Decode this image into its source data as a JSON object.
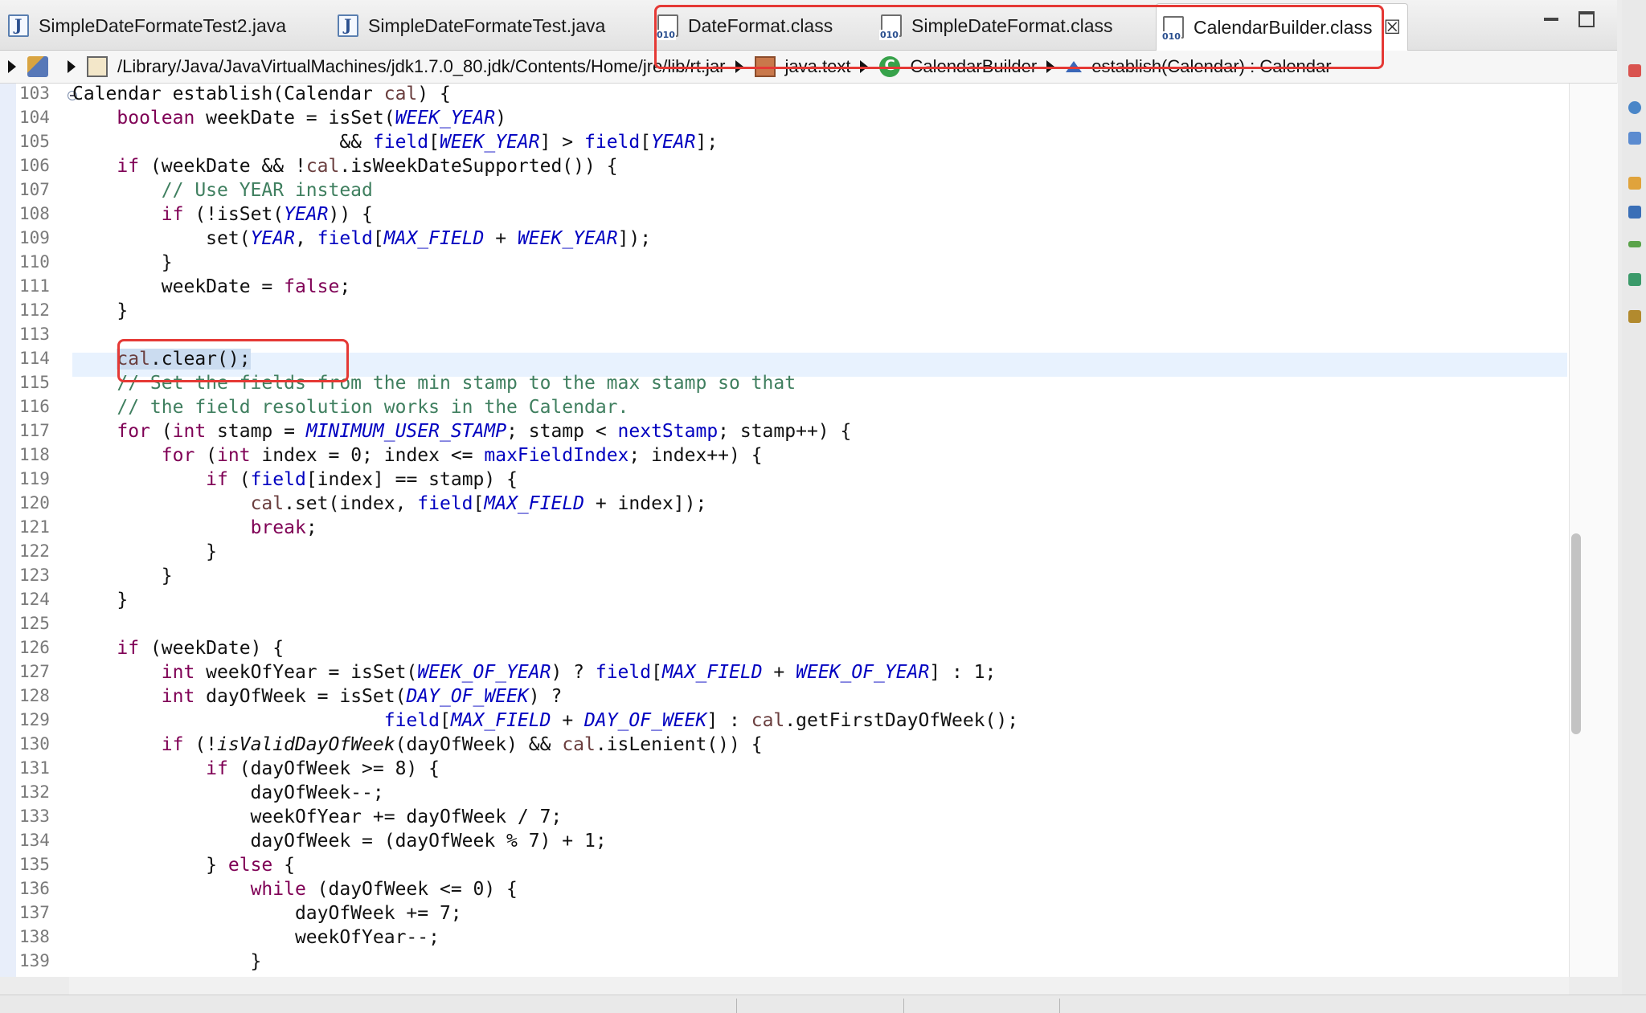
{
  "tabs": [
    {
      "label": "SimpleDateFormateTest2.java",
      "icon": "java-file-icon"
    },
    {
      "label": "SimpleDateFormateTest.java",
      "icon": "java-file-icon"
    },
    {
      "label": "DateFormat.class",
      "icon": "class-file-icon"
    },
    {
      "label": "SimpleDateFormat.class",
      "icon": "class-file-icon"
    },
    {
      "label": "CalendarBuilder.class",
      "icon": "class-file-icon",
      "active": true,
      "close_glyph": "☒"
    }
  ],
  "breadcrumb": {
    "path": "/Library/Java/JavaVirtualMachines/jdk1.7.0_80.jdk/Contents/Home/jre/lib/rt.jar",
    "package": "java.text",
    "class": "CalendarBuilder",
    "method": "establish(Calendar) : Calendar"
  },
  "editor": {
    "line_numbers": [
      "103",
      "104",
      "105",
      "106",
      "107",
      "108",
      "109",
      "110",
      "111",
      "112",
      "113",
      "114",
      "115",
      "116",
      "117",
      "118",
      "119",
      "120",
      "121",
      "122",
      "123",
      "124",
      "125",
      "126",
      "127",
      "128",
      "129",
      "130",
      "131",
      "132",
      "133",
      "134",
      "135",
      "136",
      "137",
      "138",
      "139"
    ],
    "current_line": "114",
    "code_lines": [
      "Calendar establish(Calendar cal) {",
      "    boolean weekDate = isSet(WEEK_YEAR)",
      "                        && field[WEEK_YEAR] > field[YEAR];",
      "    if (weekDate && !cal.isWeekDateSupported()) {",
      "        // Use YEAR instead",
      "        if (!isSet(YEAR)) {",
      "            set(YEAR, field[MAX_FIELD + WEEK_YEAR]);",
      "        }",
      "        weekDate = false;",
      "    }",
      "",
      "    cal.clear();",
      "    // Set the fields from the min stamp to the max stamp so that",
      "    // the field resolution works in the Calendar.",
      "    for (int stamp = MINIMUM_USER_STAMP; stamp < nextStamp; stamp++) {",
      "        for (int index = 0; index <= maxFieldIndex; index++) {",
      "            if (field[index] == stamp) {",
      "                cal.set(index, field[MAX_FIELD + index]);",
      "                break;",
      "            }",
      "        }",
      "    }",
      "",
      "    if (weekDate) {",
      "        int weekOfYear = isSet(WEEK_OF_YEAR) ? field[MAX_FIELD + WEEK_OF_YEAR] : 1;",
      "        int dayOfWeek = isSet(DAY_OF_WEEK) ?",
      "                            field[MAX_FIELD + DAY_OF_WEEK] : cal.getFirstDayOfWeek();",
      "        if (!isValidDayOfWeek(dayOfWeek) && cal.isLenient()) {",
      "            if (dayOfWeek >= 8) {",
      "                dayOfWeek--;",
      "                weekOfYear += dayOfWeek / 7;",
      "                dayOfWeek = (dayOfWeek % 7) + 1;",
      "            } else {",
      "                while (dayOfWeek <= 0) {",
      "                    dayOfWeek += 7;",
      "                    weekOfYear--;",
      "                }"
    ]
  },
  "colors": {
    "keyword": "#7f0055",
    "field": "#0000c0",
    "comment": "#3f7f5f",
    "local": "#6a3e3e",
    "annotation": "#e53935",
    "current_line": "#e8f2fe",
    "selection": "#cbdcf0"
  }
}
